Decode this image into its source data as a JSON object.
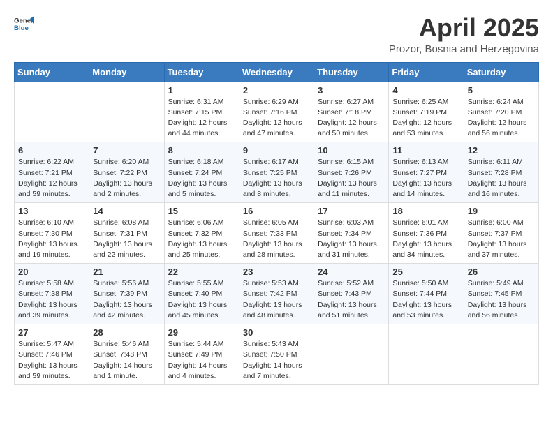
{
  "header": {
    "logo_general": "General",
    "logo_blue": "Blue",
    "title": "April 2025",
    "subtitle": "Prozor, Bosnia and Herzegovina"
  },
  "weekdays": [
    "Sunday",
    "Monday",
    "Tuesday",
    "Wednesday",
    "Thursday",
    "Friday",
    "Saturday"
  ],
  "weeks": [
    [
      null,
      null,
      {
        "day": 1,
        "sunrise": "6:31 AM",
        "sunset": "7:15 PM",
        "daylight": "12 hours and 44 minutes."
      },
      {
        "day": 2,
        "sunrise": "6:29 AM",
        "sunset": "7:16 PM",
        "daylight": "12 hours and 47 minutes."
      },
      {
        "day": 3,
        "sunrise": "6:27 AM",
        "sunset": "7:18 PM",
        "daylight": "12 hours and 50 minutes."
      },
      {
        "day": 4,
        "sunrise": "6:25 AM",
        "sunset": "7:19 PM",
        "daylight": "12 hours and 53 minutes."
      },
      {
        "day": 5,
        "sunrise": "6:24 AM",
        "sunset": "7:20 PM",
        "daylight": "12 hours and 56 minutes."
      }
    ],
    [
      {
        "day": 6,
        "sunrise": "6:22 AM",
        "sunset": "7:21 PM",
        "daylight": "12 hours and 59 minutes."
      },
      {
        "day": 7,
        "sunrise": "6:20 AM",
        "sunset": "7:22 PM",
        "daylight": "13 hours and 2 minutes."
      },
      {
        "day": 8,
        "sunrise": "6:18 AM",
        "sunset": "7:24 PM",
        "daylight": "13 hours and 5 minutes."
      },
      {
        "day": 9,
        "sunrise": "6:17 AM",
        "sunset": "7:25 PM",
        "daylight": "13 hours and 8 minutes."
      },
      {
        "day": 10,
        "sunrise": "6:15 AM",
        "sunset": "7:26 PM",
        "daylight": "13 hours and 11 minutes."
      },
      {
        "day": 11,
        "sunrise": "6:13 AM",
        "sunset": "7:27 PM",
        "daylight": "13 hours and 14 minutes."
      },
      {
        "day": 12,
        "sunrise": "6:11 AM",
        "sunset": "7:28 PM",
        "daylight": "13 hours and 16 minutes."
      }
    ],
    [
      {
        "day": 13,
        "sunrise": "6:10 AM",
        "sunset": "7:30 PM",
        "daylight": "13 hours and 19 minutes."
      },
      {
        "day": 14,
        "sunrise": "6:08 AM",
        "sunset": "7:31 PM",
        "daylight": "13 hours and 22 minutes."
      },
      {
        "day": 15,
        "sunrise": "6:06 AM",
        "sunset": "7:32 PM",
        "daylight": "13 hours and 25 minutes."
      },
      {
        "day": 16,
        "sunrise": "6:05 AM",
        "sunset": "7:33 PM",
        "daylight": "13 hours and 28 minutes."
      },
      {
        "day": 17,
        "sunrise": "6:03 AM",
        "sunset": "7:34 PM",
        "daylight": "13 hours and 31 minutes."
      },
      {
        "day": 18,
        "sunrise": "6:01 AM",
        "sunset": "7:36 PM",
        "daylight": "13 hours and 34 minutes."
      },
      {
        "day": 19,
        "sunrise": "6:00 AM",
        "sunset": "7:37 PM",
        "daylight": "13 hours and 37 minutes."
      }
    ],
    [
      {
        "day": 20,
        "sunrise": "5:58 AM",
        "sunset": "7:38 PM",
        "daylight": "13 hours and 39 minutes."
      },
      {
        "day": 21,
        "sunrise": "5:56 AM",
        "sunset": "7:39 PM",
        "daylight": "13 hours and 42 minutes."
      },
      {
        "day": 22,
        "sunrise": "5:55 AM",
        "sunset": "7:40 PM",
        "daylight": "13 hours and 45 minutes."
      },
      {
        "day": 23,
        "sunrise": "5:53 AM",
        "sunset": "7:42 PM",
        "daylight": "13 hours and 48 minutes."
      },
      {
        "day": 24,
        "sunrise": "5:52 AM",
        "sunset": "7:43 PM",
        "daylight": "13 hours and 51 minutes."
      },
      {
        "day": 25,
        "sunrise": "5:50 AM",
        "sunset": "7:44 PM",
        "daylight": "13 hours and 53 minutes."
      },
      {
        "day": 26,
        "sunrise": "5:49 AM",
        "sunset": "7:45 PM",
        "daylight": "13 hours and 56 minutes."
      }
    ],
    [
      {
        "day": 27,
        "sunrise": "5:47 AM",
        "sunset": "7:46 PM",
        "daylight": "13 hours and 59 minutes."
      },
      {
        "day": 28,
        "sunrise": "5:46 AM",
        "sunset": "7:48 PM",
        "daylight": "14 hours and 1 minute."
      },
      {
        "day": 29,
        "sunrise": "5:44 AM",
        "sunset": "7:49 PM",
        "daylight": "14 hours and 4 minutes."
      },
      {
        "day": 30,
        "sunrise": "5:43 AM",
        "sunset": "7:50 PM",
        "daylight": "14 hours and 7 minutes."
      },
      null,
      null,
      null
    ]
  ],
  "labels": {
    "sunrise": "Sunrise:",
    "sunset": "Sunset:",
    "daylight": "Daylight:"
  }
}
